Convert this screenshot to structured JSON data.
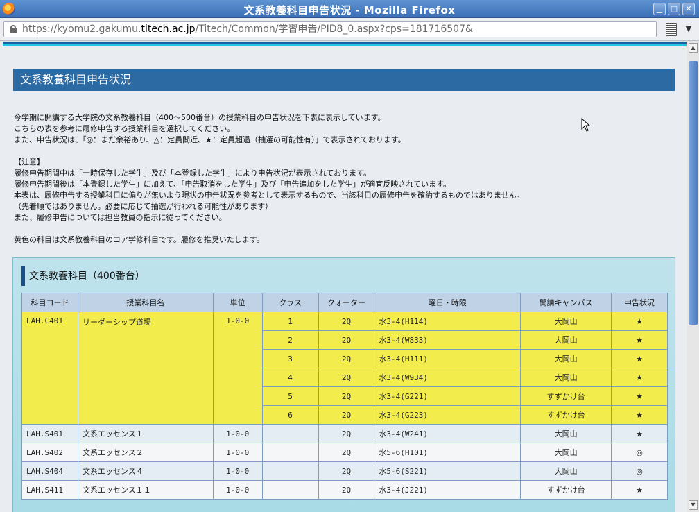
{
  "window": {
    "title": "文系教養科目申告状況 - Mozilla Firefox"
  },
  "urlbar": {
    "prefix": "https://kyomu2.gakumu.",
    "host": "titech.ac.jp",
    "path": "/Titech/Common/学習申告/PID8_0.aspx?cps=181716507&"
  },
  "page": {
    "heading": "文系教養科目申告状況",
    "intro": [
      "今学期に開講する大学院の文系教養科目（400～500番台）の授業科目の申告状況を下表に表示しています。",
      "こちらの表を参考に履修申告する授業科目を選択してください。",
      "また、申告状況は、「◎：まだ余裕あり、△：定員間近、★：定員超過（抽選の可能性有）」で表示されております。",
      "",
      "【注意】",
      "履修申告期間中は「一時保存した学生」及び「本登録した学生」により申告状況が表示されております。",
      "履修申告期間後は「本登録した学生」に加えて、「申告取消をした学生」及び「申告追加をした学生」が適宜反映されています。",
      "本表は、履修申告する授業科目に偏りが無いよう現状の申告状況を参考として表示するもので、当該科目の履修申告を確約するものではありません。",
      "（先着順ではありません。必要に応じて抽選が行われる可能性があります）",
      "また、履修申告については担当教員の指示に従ってください。",
      "",
      "黄色の科目は文系教養科目のコア学修科目です。履修を推奨いたします。"
    ],
    "section_title": "文系教養科目（400番台）",
    "table": {
      "headers": [
        "科目コード",
        "授業科目名",
        "単位",
        "クラス",
        "クォーター",
        "曜日・時限",
        "開講キャンパス",
        "申告状況"
      ],
      "core_course": {
        "code": "LAH.C401",
        "name": "リーダーシップ道場",
        "credits": "1-0-0",
        "classes": [
          {
            "cls": "1",
            "quarter": "2Q",
            "period": "水3-4(H114)",
            "campus": "大岡山",
            "status": "★"
          },
          {
            "cls": "2",
            "quarter": "2Q",
            "period": "水3-4(W833)",
            "campus": "大岡山",
            "status": "★"
          },
          {
            "cls": "3",
            "quarter": "2Q",
            "period": "水3-4(H111)",
            "campus": "大岡山",
            "status": "★"
          },
          {
            "cls": "4",
            "quarter": "2Q",
            "period": "水3-4(W934)",
            "campus": "大岡山",
            "status": "★"
          },
          {
            "cls": "5",
            "quarter": "2Q",
            "period": "水3-4(G221)",
            "campus": "すずかけ台",
            "status": "★"
          },
          {
            "cls": "6",
            "quarter": "2Q",
            "period": "水3-4(G223)",
            "campus": "すずかけ台",
            "status": "★"
          }
        ]
      },
      "rows": [
        {
          "code": "LAH.S401",
          "name": "文系エッセンス１",
          "credits": "1-0-0",
          "cls": "",
          "quarter": "2Q",
          "period": "水3-4(W241)",
          "campus": "大岡山",
          "status": "★"
        },
        {
          "code": "LAH.S402",
          "name": "文系エッセンス２",
          "credits": "1-0-0",
          "cls": "",
          "quarter": "2Q",
          "period": "水5-6(H101)",
          "campus": "大岡山",
          "status": "◎"
        },
        {
          "code": "LAH.S404",
          "name": "文系エッセンス４",
          "credits": "1-0-0",
          "cls": "",
          "quarter": "2Q",
          "period": "水5-6(S221)",
          "campus": "大岡山",
          "status": "◎"
        },
        {
          "code": "LAH.S411",
          "name": "文系エッセンス１１",
          "credits": "1-0-0",
          "cls": "",
          "quarter": "2Q",
          "period": "水3-4(J221)",
          "campus": "すずかけ台",
          "status": "★"
        }
      ]
    }
  },
  "colors": {
    "heading_bg": "#2c6aa4",
    "core_row": "#f2ec4c",
    "section_bg": "#a7dbe6"
  }
}
